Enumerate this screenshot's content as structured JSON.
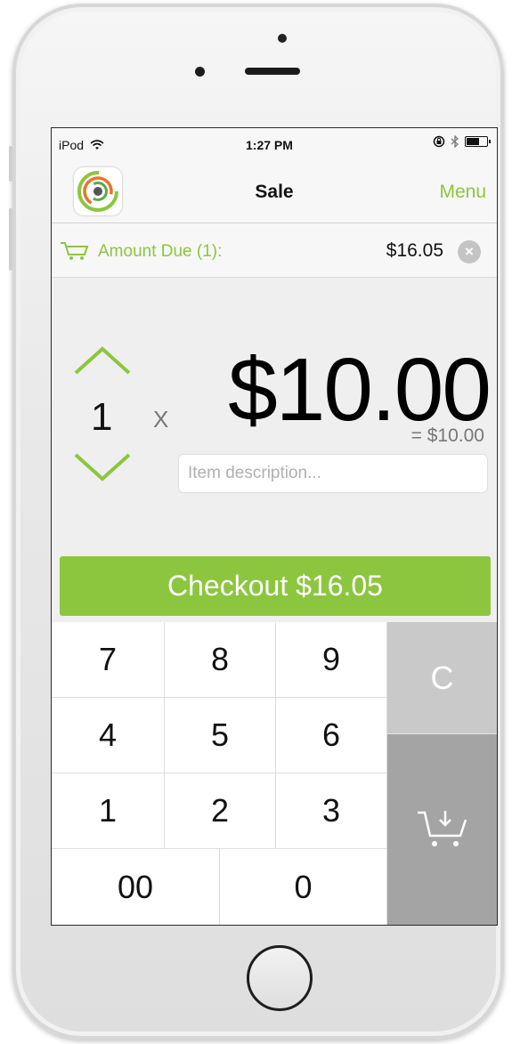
{
  "status_bar": {
    "carrier": "iPod",
    "time": "1:27 PM"
  },
  "nav": {
    "title": "Sale",
    "menu_label": "Menu"
  },
  "amount_due": {
    "label": "Amount Due (1):",
    "value": "$16.05"
  },
  "item": {
    "quantity": "1",
    "times_sign": "X",
    "price": "$10.00",
    "subtotal": "= $10.00",
    "description_placeholder": "Item description..."
  },
  "checkout": {
    "label": "Checkout $16.05"
  },
  "keypad": {
    "keys": [
      "7",
      "8",
      "9",
      "4",
      "5",
      "6",
      "1",
      "2",
      "3",
      "00",
      "0"
    ],
    "clear_label": "C"
  },
  "colors": {
    "accent_green": "#8cc63f",
    "clear_key": "#c9c9c9",
    "cart_key": "#a4a4a4"
  },
  "icons": [
    "wifi-icon",
    "orientation-lock-icon",
    "bluetooth-icon",
    "battery-icon",
    "app-logo-icon",
    "cart-icon",
    "clear-amount-icon",
    "chevron-up-icon",
    "chevron-down-icon",
    "add-to-cart-icon"
  ]
}
